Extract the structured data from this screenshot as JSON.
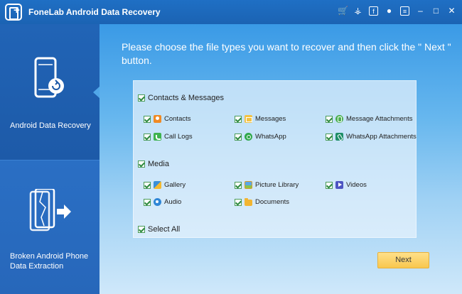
{
  "app": {
    "title": "FoneLab Android Data Recovery"
  },
  "titlebar_icons": [
    "cart-icon",
    "key-icon",
    "facebook-icon",
    "chat-icon",
    "feedback-icon",
    "minimize-icon",
    "maximize-icon",
    "close-icon"
  ],
  "sidebar": {
    "items": [
      {
        "label": "Android Data Recovery",
        "icon": "phone-recover-icon",
        "active": true
      },
      {
        "label_line1": "Broken Android Phone",
        "label_line2": "Data Extraction",
        "icon": "broken-phone-icon",
        "active": false
      }
    ]
  },
  "main": {
    "prompt": "Please choose the file types you want to recover and then click the \" Next \" button.",
    "groups": {
      "contacts_messages": {
        "label": "Contacts & Messages",
        "checked": true,
        "options": [
          {
            "label": "Contacts",
            "icon": "contacts-icon",
            "checked": true
          },
          {
            "label": "Messages",
            "icon": "messages-icon",
            "checked": true
          },
          {
            "label": "Message Attachments",
            "icon": "message-attachments-icon",
            "checked": true
          },
          {
            "label": "Call Logs",
            "icon": "call-logs-icon",
            "checked": true
          },
          {
            "label": "WhatsApp",
            "icon": "whatsapp-icon",
            "checked": true
          },
          {
            "label": "WhatsApp Attachments",
            "icon": "whatsapp-attachments-icon",
            "checked": true
          }
        ]
      },
      "media": {
        "label": "Media",
        "checked": true,
        "options": [
          {
            "label": "Gallery",
            "icon": "gallery-icon",
            "checked": true
          },
          {
            "label": "Picture Library",
            "icon": "picture-library-icon",
            "checked": true
          },
          {
            "label": "Videos",
            "icon": "videos-icon",
            "checked": true
          },
          {
            "label": "Audio",
            "icon": "audio-icon",
            "checked": true
          },
          {
            "label": "Documents",
            "icon": "documents-icon",
            "checked": true
          }
        ]
      }
    },
    "select_all": {
      "label": "Select All",
      "checked": true
    },
    "next_button": "Next"
  },
  "colors": {
    "titlebar": "#1f6fc4",
    "sidebar_active": "#2164b6",
    "accent_button": "#f8c74e",
    "checkbox_check": "#2f8a3f"
  }
}
